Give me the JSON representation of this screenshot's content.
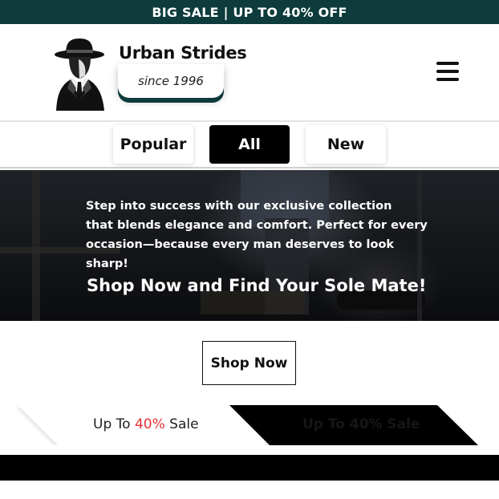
{
  "promo": {
    "text": "BIG SALE | UP TO 40% OFF"
  },
  "header": {
    "brand": "Urban Strides",
    "tagline": "since 1996",
    "menu_icon": "hamburger-menu-icon",
    "logo_icon": "fedora-man-silhouette-icon"
  },
  "filters": {
    "items": [
      {
        "label": "Popular",
        "active": false
      },
      {
        "label": "All",
        "active": true
      },
      {
        "label": "New",
        "active": false
      }
    ]
  },
  "hero": {
    "lines": [
      "Step into success with our exclusive collection",
      "that blends elegance and comfort. Perfect for every",
      "occasion—because every man deserves to look sharp!"
    ],
    "cta_text": "Shop Now and Find Your Sole Mate!"
  },
  "shop_now": {
    "label": "Shop Now"
  },
  "sale_banner": {
    "prefix": "Up To ",
    "percent": "40%",
    "suffix": " Sale",
    "dark_text": "Up To 40% Sale"
  },
  "colors": {
    "promo_bg": "#0e3b3b",
    "accent_red": "#e63333",
    "active_filter_bg": "#000000"
  }
}
